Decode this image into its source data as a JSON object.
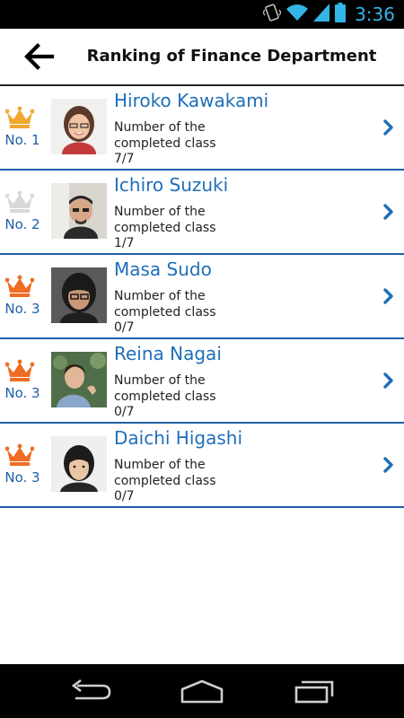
{
  "status_bar": {
    "time": "3:36",
    "icons": [
      "vibrate-icon",
      "wifi-icon",
      "signal-icon",
      "battery-icon"
    ]
  },
  "header": {
    "back_icon": "arrow-left-icon",
    "title": "Ranking of Finance Department"
  },
  "colors": {
    "accent": "#1f6fb8",
    "divider": "#1f5fa8",
    "crown_gold": "#f0a830",
    "crown_silver": "#d8d8d8",
    "crown_bronze": "#ef6c22"
  },
  "ranking": [
    {
      "rank": "No. 1",
      "crown": "gold-crown-icon",
      "name": "Hiroko Kawakami",
      "label": "Number of the completed class",
      "value": "7/7"
    },
    {
      "rank": "No. 2",
      "crown": "silver-crown-icon",
      "name": "Ichiro Suzuki",
      "label": "Number of the completed class",
      "value": "1/7"
    },
    {
      "rank": "No. 3",
      "crown": "bronze-crown-icon",
      "name": "Masa Sudo",
      "label": "Number of the completed class",
      "value": "0/7"
    },
    {
      "rank": "No. 3",
      "crown": "bronze-crown-icon",
      "name": "Reina Nagai",
      "label": "Number of the completed class",
      "value": "0/7"
    },
    {
      "rank": "No. 3",
      "crown": "bronze-crown-icon",
      "name": "Daichi Higashi",
      "label": "Number of the completed class",
      "value": "0/7"
    }
  ],
  "nav_bar": [
    "back-icon",
    "home-icon",
    "recent-apps-icon"
  ]
}
